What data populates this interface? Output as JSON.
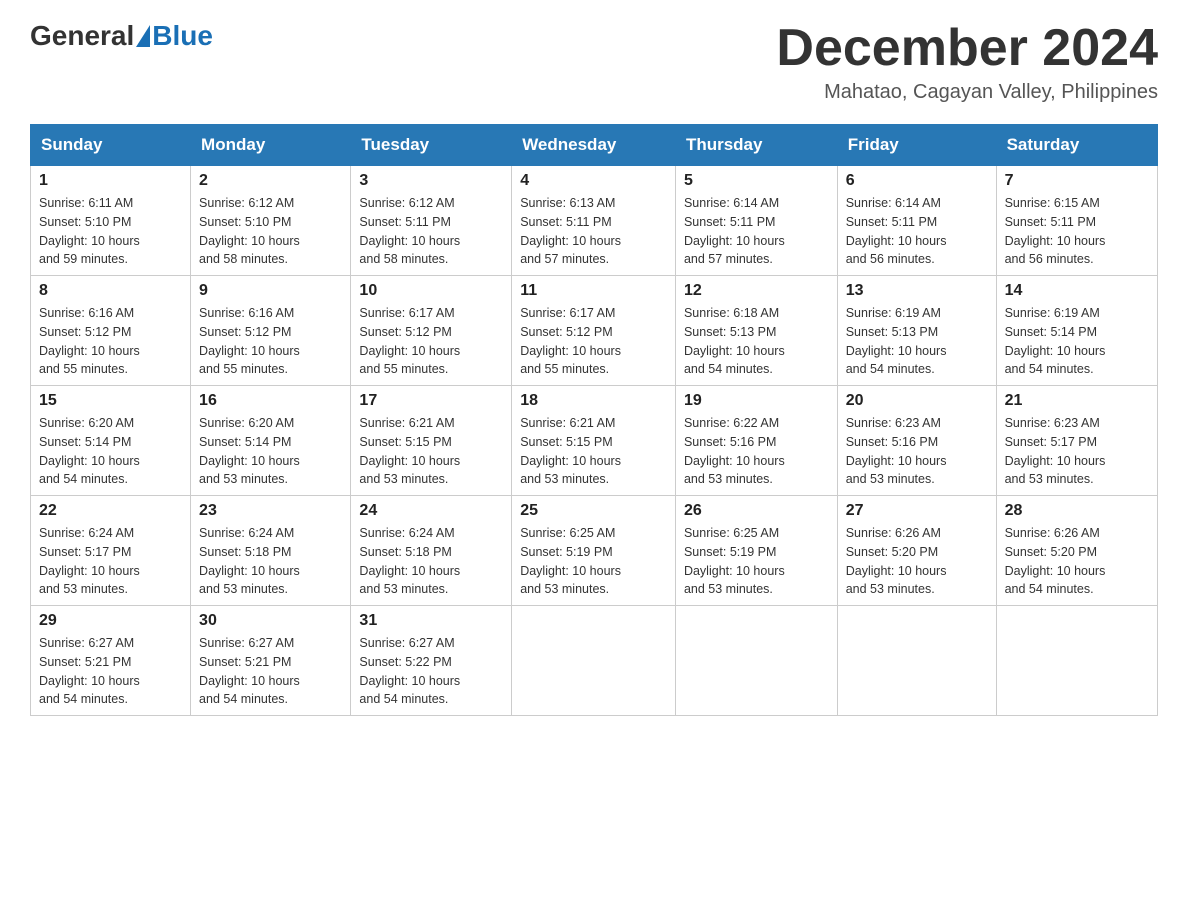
{
  "header": {
    "logo_general": "General",
    "logo_blue": "Blue",
    "month_title": "December 2024",
    "location": "Mahatao, Cagayan Valley, Philippines"
  },
  "weekdays": [
    "Sunday",
    "Monday",
    "Tuesday",
    "Wednesday",
    "Thursday",
    "Friday",
    "Saturday"
  ],
  "weeks": [
    [
      {
        "day": "1",
        "sunrise": "6:11 AM",
        "sunset": "5:10 PM",
        "daylight": "10 hours and 59 minutes."
      },
      {
        "day": "2",
        "sunrise": "6:12 AM",
        "sunset": "5:10 PM",
        "daylight": "10 hours and 58 minutes."
      },
      {
        "day": "3",
        "sunrise": "6:12 AM",
        "sunset": "5:11 PM",
        "daylight": "10 hours and 58 minutes."
      },
      {
        "day": "4",
        "sunrise": "6:13 AM",
        "sunset": "5:11 PM",
        "daylight": "10 hours and 57 minutes."
      },
      {
        "day": "5",
        "sunrise": "6:14 AM",
        "sunset": "5:11 PM",
        "daylight": "10 hours and 57 minutes."
      },
      {
        "day": "6",
        "sunrise": "6:14 AM",
        "sunset": "5:11 PM",
        "daylight": "10 hours and 56 minutes."
      },
      {
        "day": "7",
        "sunrise": "6:15 AM",
        "sunset": "5:11 PM",
        "daylight": "10 hours and 56 minutes."
      }
    ],
    [
      {
        "day": "8",
        "sunrise": "6:16 AM",
        "sunset": "5:12 PM",
        "daylight": "10 hours and 55 minutes."
      },
      {
        "day": "9",
        "sunrise": "6:16 AM",
        "sunset": "5:12 PM",
        "daylight": "10 hours and 55 minutes."
      },
      {
        "day": "10",
        "sunrise": "6:17 AM",
        "sunset": "5:12 PM",
        "daylight": "10 hours and 55 minutes."
      },
      {
        "day": "11",
        "sunrise": "6:17 AM",
        "sunset": "5:12 PM",
        "daylight": "10 hours and 55 minutes."
      },
      {
        "day": "12",
        "sunrise": "6:18 AM",
        "sunset": "5:13 PM",
        "daylight": "10 hours and 54 minutes."
      },
      {
        "day": "13",
        "sunrise": "6:19 AM",
        "sunset": "5:13 PM",
        "daylight": "10 hours and 54 minutes."
      },
      {
        "day": "14",
        "sunrise": "6:19 AM",
        "sunset": "5:14 PM",
        "daylight": "10 hours and 54 minutes."
      }
    ],
    [
      {
        "day": "15",
        "sunrise": "6:20 AM",
        "sunset": "5:14 PM",
        "daylight": "10 hours and 54 minutes."
      },
      {
        "day": "16",
        "sunrise": "6:20 AM",
        "sunset": "5:14 PM",
        "daylight": "10 hours and 53 minutes."
      },
      {
        "day": "17",
        "sunrise": "6:21 AM",
        "sunset": "5:15 PM",
        "daylight": "10 hours and 53 minutes."
      },
      {
        "day": "18",
        "sunrise": "6:21 AM",
        "sunset": "5:15 PM",
        "daylight": "10 hours and 53 minutes."
      },
      {
        "day": "19",
        "sunrise": "6:22 AM",
        "sunset": "5:16 PM",
        "daylight": "10 hours and 53 minutes."
      },
      {
        "day": "20",
        "sunrise": "6:23 AM",
        "sunset": "5:16 PM",
        "daylight": "10 hours and 53 minutes."
      },
      {
        "day": "21",
        "sunrise": "6:23 AM",
        "sunset": "5:17 PM",
        "daylight": "10 hours and 53 minutes."
      }
    ],
    [
      {
        "day": "22",
        "sunrise": "6:24 AM",
        "sunset": "5:17 PM",
        "daylight": "10 hours and 53 minutes."
      },
      {
        "day": "23",
        "sunrise": "6:24 AM",
        "sunset": "5:18 PM",
        "daylight": "10 hours and 53 minutes."
      },
      {
        "day": "24",
        "sunrise": "6:24 AM",
        "sunset": "5:18 PM",
        "daylight": "10 hours and 53 minutes."
      },
      {
        "day": "25",
        "sunrise": "6:25 AM",
        "sunset": "5:19 PM",
        "daylight": "10 hours and 53 minutes."
      },
      {
        "day": "26",
        "sunrise": "6:25 AM",
        "sunset": "5:19 PM",
        "daylight": "10 hours and 53 minutes."
      },
      {
        "day": "27",
        "sunrise": "6:26 AM",
        "sunset": "5:20 PM",
        "daylight": "10 hours and 53 minutes."
      },
      {
        "day": "28",
        "sunrise": "6:26 AM",
        "sunset": "5:20 PM",
        "daylight": "10 hours and 54 minutes."
      }
    ],
    [
      {
        "day": "29",
        "sunrise": "6:27 AM",
        "sunset": "5:21 PM",
        "daylight": "10 hours and 54 minutes."
      },
      {
        "day": "30",
        "sunrise": "6:27 AM",
        "sunset": "5:21 PM",
        "daylight": "10 hours and 54 minutes."
      },
      {
        "day": "31",
        "sunrise": "6:27 AM",
        "sunset": "5:22 PM",
        "daylight": "10 hours and 54 minutes."
      },
      null,
      null,
      null,
      null
    ]
  ],
  "labels": {
    "sunrise": "Sunrise:",
    "sunset": "Sunset:",
    "daylight": "Daylight:"
  }
}
